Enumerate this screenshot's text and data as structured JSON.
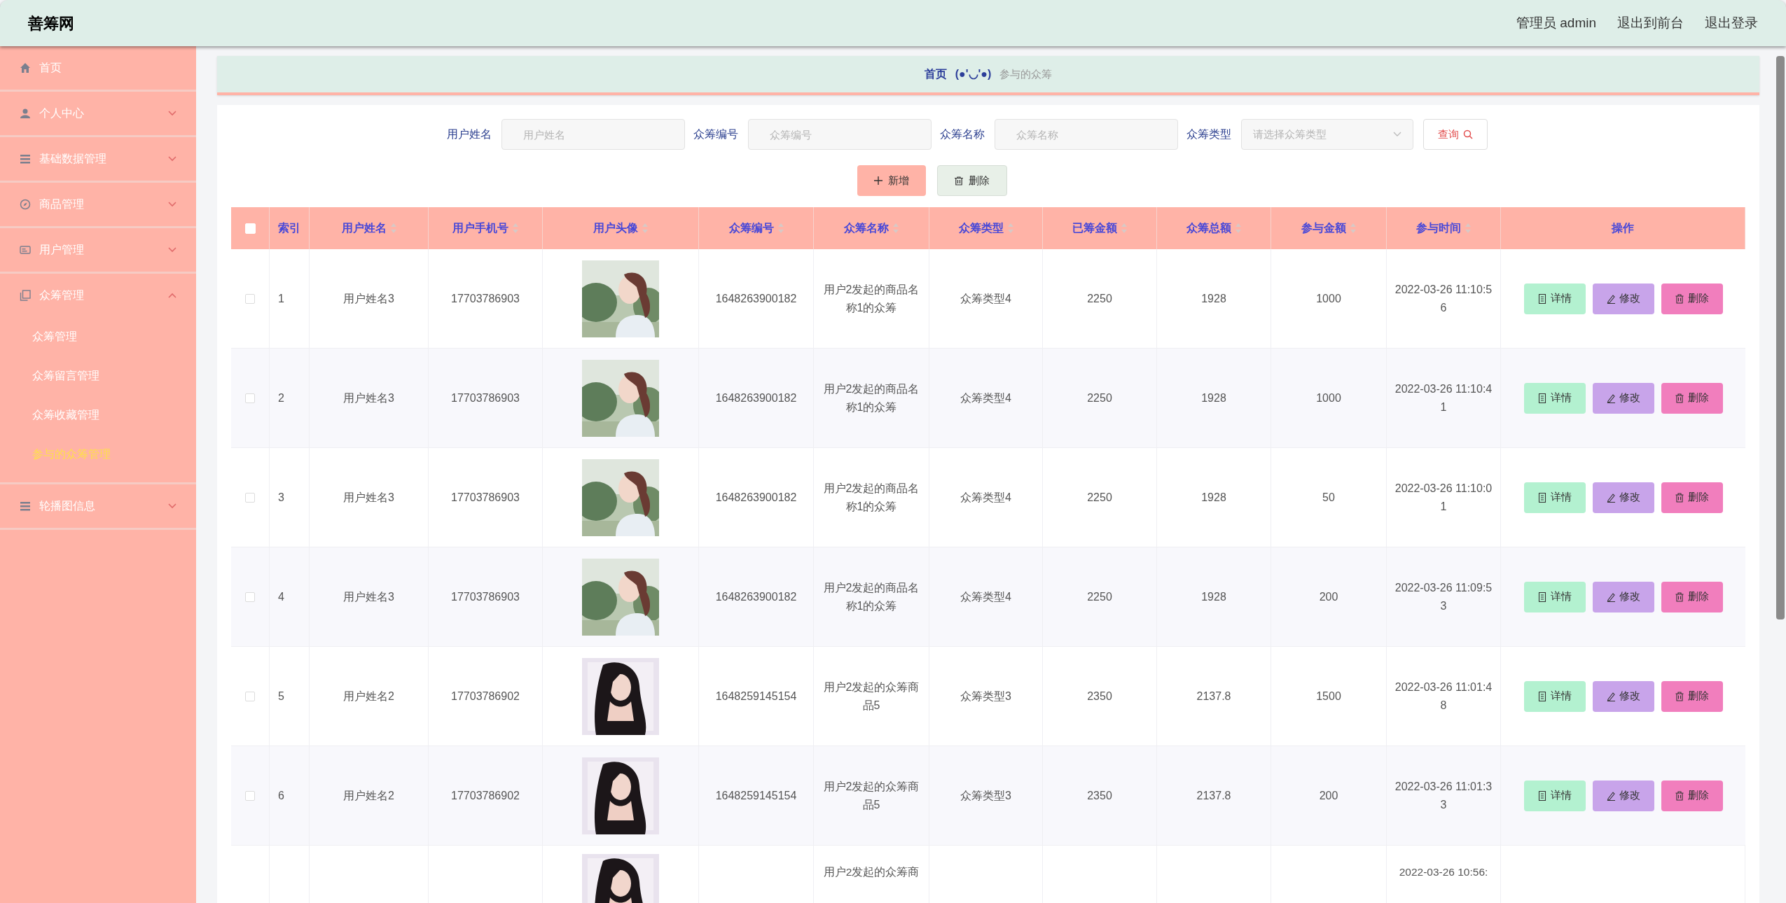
{
  "header": {
    "title": "善筹网",
    "links": [
      "管理员 admin",
      "退出到前台",
      "退出登录"
    ]
  },
  "sidebar": {
    "items": [
      {
        "kind": "link",
        "label": "首页"
      },
      {
        "kind": "group",
        "label": "个人中心",
        "expanded": false
      },
      {
        "kind": "group",
        "label": "基础数据管理",
        "expanded": false
      },
      {
        "kind": "group",
        "label": "商品管理",
        "expanded": false
      },
      {
        "kind": "group",
        "label": "用户管理",
        "expanded": false
      },
      {
        "kind": "group",
        "label": "众筹管理",
        "expanded": true,
        "children": [
          {
            "label": "众筹管理",
            "selected": false
          },
          {
            "label": "众筹留言管理",
            "selected": false
          },
          {
            "label": "众筹收藏管理",
            "selected": false
          },
          {
            "label": "参与的众筹管理",
            "selected": true
          }
        ]
      },
      {
        "kind": "group",
        "label": "轮播图信息",
        "expanded": false
      }
    ]
  },
  "breadcrumb": {
    "home": "首页",
    "emoticon": "(●'◡'●)",
    "current": "参与的众筹"
  },
  "filters": [
    {
      "kind": "input",
      "label": "用户姓名",
      "placeholder": "用户姓名"
    },
    {
      "kind": "input",
      "label": "众筹编号",
      "placeholder": "众筹编号"
    },
    {
      "kind": "input",
      "label": "众筹名称",
      "placeholder": "众筹名称"
    },
    {
      "kind": "select",
      "label": "众筹类型",
      "placeholder": "请选择众筹类型"
    }
  ],
  "search_button": "查询",
  "actions": [
    {
      "kind": "add",
      "label": "新增"
    },
    {
      "kind": "delete",
      "label": "删除"
    }
  ],
  "table": {
    "header_checked": false,
    "columns": [
      {
        "label": "索引",
        "sortable": false
      },
      {
        "label": "用户姓名",
        "sortable": true
      },
      {
        "label": "用户手机号",
        "sortable": true
      },
      {
        "label": "用户头像",
        "sortable": true
      },
      {
        "label": "众筹编号",
        "sortable": true
      },
      {
        "label": "众筹名称",
        "sortable": true
      },
      {
        "label": "众筹类型",
        "sortable": true
      },
      {
        "label": "已筹金额",
        "sortable": true
      },
      {
        "label": "众筹总额",
        "sortable": true
      },
      {
        "label": "参与金额",
        "sortable": true
      },
      {
        "label": "参与时间",
        "sortable": true
      },
      {
        "label": "操作",
        "sortable": false
      }
    ],
    "rows": [
      {
        "checked": false,
        "cells": [
          "1",
          "用户姓名3",
          "17703786903",
          {
            "kind": "picture"
          },
          "1648263900182",
          "用户2发起的商品名称1的众筹",
          "众筹类型4",
          "2250",
          "1928",
          "1000",
          "2022-03-26 11:10:56"
        ],
        "buttons": [
          "详情",
          "修改",
          "删除"
        ]
      },
      {
        "checked": false,
        "cells": [
          "2",
          "用户姓名3",
          "17703786903",
          {
            "kind": "picture"
          },
          "1648263900182",
          "用户2发起的商品名称1的众筹",
          "众筹类型4",
          "2250",
          "1928",
          "1000",
          "2022-03-26 11:10:41"
        ],
        "buttons": [
          "详情",
          "修改",
          "删除"
        ]
      },
      {
        "checked": false,
        "cells": [
          "3",
          "用户姓名3",
          "17703786903",
          {
            "kind": "picture"
          },
          "1648263900182",
          "用户2发起的商品名称1的众筹",
          "众筹类型4",
          "2250",
          "1928",
          "50",
          "2022-03-26 11:10:01"
        ],
        "buttons": [
          "详情",
          "修改",
          "删除"
        ]
      },
      {
        "checked": false,
        "cells": [
          "4",
          "用户姓名3",
          "17703786903",
          {
            "kind": "picture"
          },
          "1648263900182",
          "用户2发起的商品名称1的众筹",
          "众筹类型4",
          "2250",
          "1928",
          "200",
          "2022-03-26 11:09:53"
        ],
        "buttons": [
          "详情",
          "修改",
          "删除"
        ]
      },
      {
        "checked": false,
        "cells": [
          "5",
          "用户姓名2",
          "17703786902",
          {
            "kind": "picture"
          },
          "1648259145154",
          "用户2发起的众筹商品5",
          "众筹类型3",
          "2350",
          "2137.8",
          "1500",
          "2022-03-26 11:01:48"
        ],
        "buttons": [
          "详情",
          "修改",
          "删除"
        ]
      },
      {
        "checked": false,
        "cells": [
          "6",
          "用户姓名2",
          "17703786902",
          {
            "kind": "picture"
          },
          "1648259145154",
          "用户2发起的众筹商品5",
          "众筹类型3",
          "2350",
          "2137.8",
          "200",
          "2022-03-26 11:01:33"
        ],
        "buttons": [
          "详情",
          "修改",
          "删除"
        ]
      }
    ],
    "partial_row": {
      "name": "用户2发起的众筹商",
      "time": "2022-03-26 10:56:"
    }
  }
}
